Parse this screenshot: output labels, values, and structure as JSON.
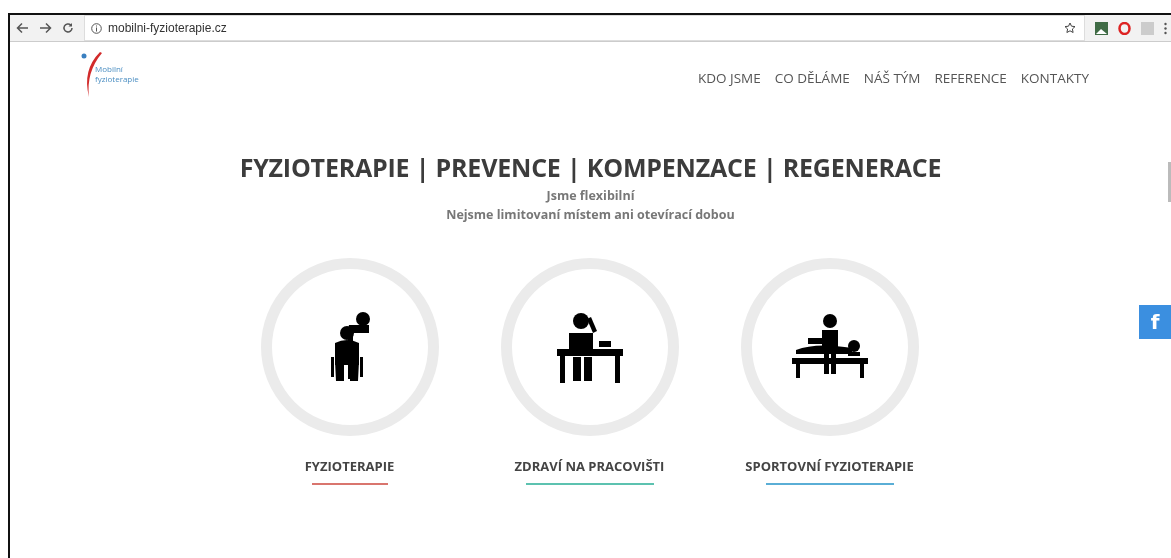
{
  "browser": {
    "url": "mobilni-fyzioterapie.cz"
  },
  "logo": {
    "line1": "Mobilní",
    "line2": "fyzioterapie"
  },
  "nav": [
    "KDO JSME",
    "CO DĚLÁME",
    "NÁŠ TÝM",
    "REFERENCE",
    "KONTAKTY"
  ],
  "hero": {
    "title": "FYZIOTERAPIE | PREVENCE | KOMPENZACE | REGENERACE",
    "subtitle": "Jsme flexibilní",
    "tagline": "Nejsme limitovaní místem ani otevírací dobou"
  },
  "services": [
    {
      "kind": "care",
      "label": "FYZIOTERAPIE",
      "color": "#d9756e"
    },
    {
      "kind": "desk",
      "label": "ZDRAVÍ NA PRACOVIŠTI",
      "color": "#5cc2b0"
    },
    {
      "kind": "massage",
      "label": "SPORTOVNÍ FYZIOTERAPIE",
      "color": "#5aaed6"
    }
  ],
  "social": {
    "label": "f"
  }
}
